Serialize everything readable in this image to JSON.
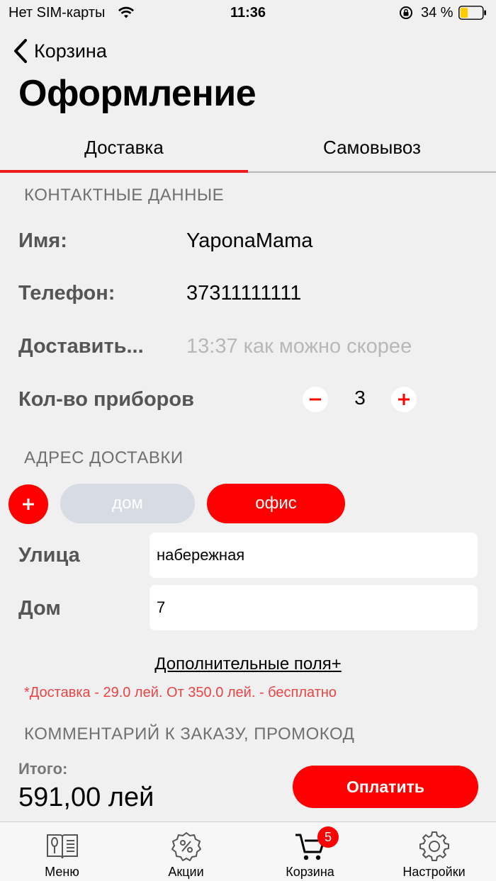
{
  "status_bar": {
    "carrier": "Нет SIM-карты",
    "time": "11:36",
    "battery_percent": "34 %",
    "battery_level": 0.34,
    "battery_color": "#ffcc00"
  },
  "nav": {
    "back_label": "Корзина",
    "title": "Оформление"
  },
  "tabs": [
    {
      "label": "Доставка",
      "active": true
    },
    {
      "label": "Самовывоз",
      "active": false
    }
  ],
  "contact": {
    "section_title": "КОНТАКТНЫЕ ДАННЫЕ",
    "name_label": "Имя:",
    "name_value": "YaponaMama",
    "phone_label": "Телефон:",
    "phone_value": "37311111111",
    "deliver_label": "Доставить...",
    "deliver_placeholder": "13:37 как можно скорее",
    "cutlery_label": "Кол-во приборов",
    "cutlery_count": "3"
  },
  "address": {
    "section_title": "АДРЕС ДОСТАВКИ",
    "chips": [
      {
        "label": "дом",
        "selected": false
      },
      {
        "label": "офис",
        "selected": true
      }
    ],
    "street_label": "Улица",
    "street_value": "набережная",
    "house_label": "Дом",
    "house_value": "7"
  },
  "more_fields_link": "Дополнительные поля+",
  "delivery_note": "*Доставка - 29.0 лей. От 350.0 лей. - бесплатно",
  "comment_section_title": "КОММЕНТАРИЙ К ЗАКАЗУ, ПРОМОКОД",
  "summary": {
    "total_label": "Итого:",
    "total_value": "591,00 лей",
    "pay_button": "Оплатить"
  },
  "tabbar": {
    "items": [
      {
        "label": "Меню",
        "icon": "menu-book-icon"
      },
      {
        "label": "Акции",
        "icon": "discount-badge-icon"
      },
      {
        "label": "Корзина",
        "icon": "cart-icon",
        "badge": "5"
      },
      {
        "label": "Настройки",
        "icon": "gear-icon"
      }
    ]
  },
  "colors": {
    "accent": "#ff0000",
    "note": "#e84545",
    "chip_inactive": "#d7dbe4"
  }
}
